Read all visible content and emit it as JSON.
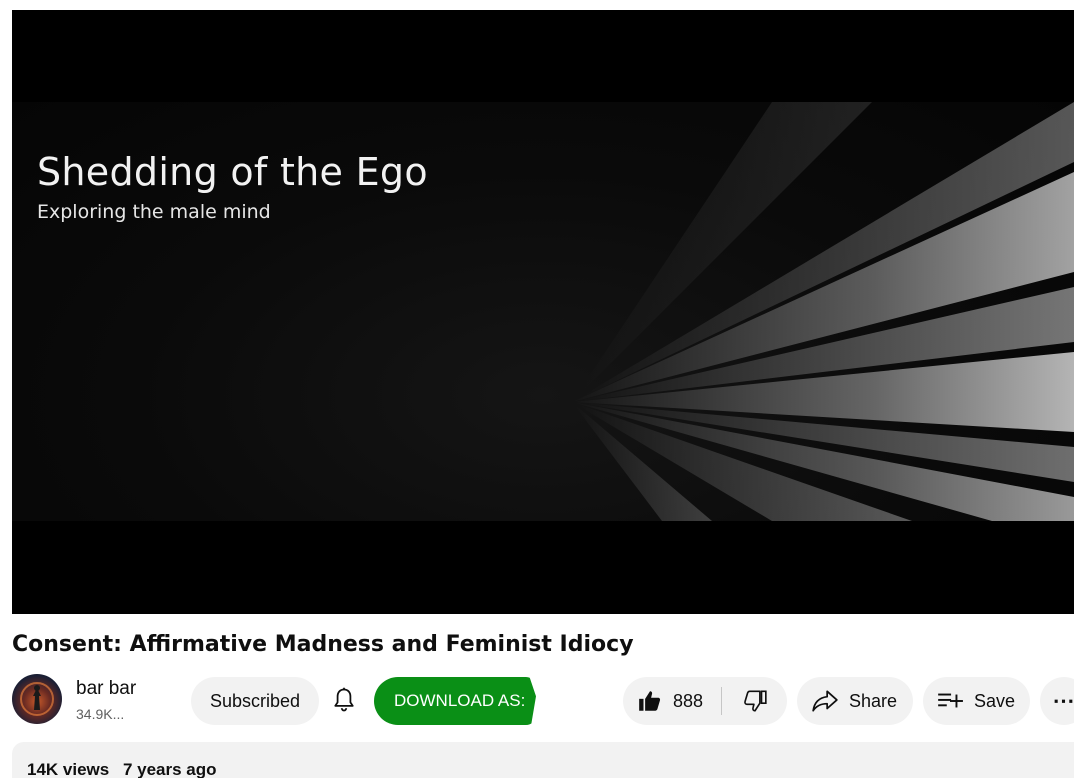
{
  "video": {
    "banner_title": "Shedding of the Ego",
    "banner_subtitle": "Exploring the male mind",
    "title": "Consent: Affirmative Madness and Feminist Idiocy"
  },
  "channel": {
    "name": "bar bar",
    "subscribers": "34.9K..."
  },
  "actions": {
    "subscribed_label": "Subscribed",
    "download_label": "DOWNLOAD AS:",
    "like_count": "888",
    "share_label": "Share",
    "save_label": "Save",
    "more_label": "⋯"
  },
  "description": {
    "views": "14K views",
    "age": "7 years ago"
  },
  "icons": {
    "bell": "bell-icon",
    "like": "thumbs-up-icon",
    "dislike": "thumbs-down-icon",
    "share": "share-arrow-icon",
    "save": "playlist-add-icon"
  },
  "colors": {
    "download_green": "#0a8f16",
    "pill_bg": "#f2f2f2",
    "text_primary": "#0f0f0f",
    "text_secondary": "#606060"
  }
}
